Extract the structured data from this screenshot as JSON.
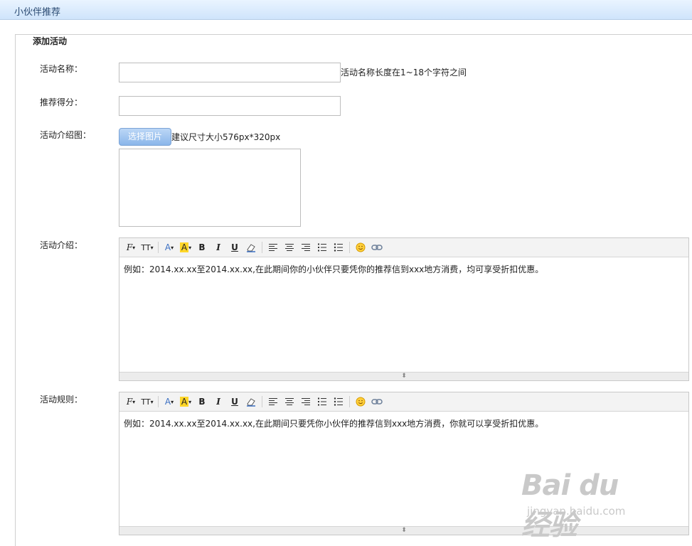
{
  "header": {
    "title": "小伙伴推荐"
  },
  "form": {
    "legend": "添加活动",
    "name": {
      "label": "活动名称：",
      "value": "",
      "hint": "活动名称长度在1~18个字符之间"
    },
    "score": {
      "label": "推荐得分：",
      "value": ""
    },
    "image": {
      "label": "活动介绍图：",
      "button": "选择图片",
      "hint": "建议尺寸大小576px*320px"
    },
    "intro": {
      "label": "活动介绍：",
      "content": "例如：2014.xx.xx至2014.xx.xx,在此期间你的小伙伴只要凭你的推荐信到xxx地方消费，均可享受折扣优惠。"
    },
    "rules": {
      "label": "活动规则：",
      "content": "例如：2014.xx.xx至2014.xx.xx,在此期间只要凭你小伙伴的推荐信到xxx地方消费，你就可以享受折扣优惠。"
    }
  },
  "toolbar": {
    "font_family": "F",
    "font_size": "TT",
    "font_color": "A",
    "highlight": "A",
    "bold": "B",
    "italic": "I",
    "underline": "U"
  },
  "watermark": {
    "logo": "Bai du 经验",
    "url": "jingyan.baidu.com"
  }
}
